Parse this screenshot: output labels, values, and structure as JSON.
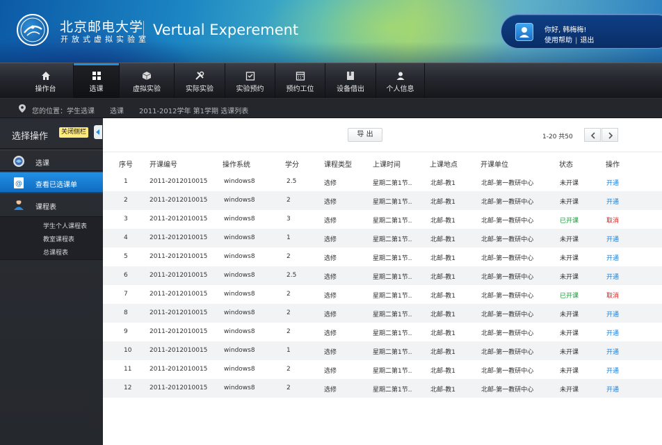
{
  "header": {
    "university": "北京邮电大学",
    "lab": "开放式虚拟实验室",
    "app_title": "Vertual Experement",
    "greeting": "你好, 韩梅梅!",
    "help": "使用帮助",
    "logout": "退出",
    "link_separator": "|"
  },
  "nav": [
    {
      "label": "操作台",
      "icon": "home-icon"
    },
    {
      "label": "选课",
      "icon": "grid-icon",
      "active": true
    },
    {
      "label": "虚拟实验",
      "icon": "cube-icon"
    },
    {
      "label": "实际实验",
      "icon": "tools-icon"
    },
    {
      "label": "实验预约",
      "icon": "calendar-check-icon"
    },
    {
      "label": "预约工位",
      "icon": "calendar-icon"
    },
    {
      "label": "设备借出",
      "icon": "book-icon"
    },
    {
      "label": "个人信息",
      "icon": "person-icon"
    }
  ],
  "breadcrumb": {
    "prefix": "您的位置：学生选课",
    "level2": "选课",
    "level3": "2011-2012学年 第1学期 选课列表"
  },
  "sidebar": {
    "title": "选择操作",
    "close_label": "关闭侧栏",
    "items": [
      {
        "label": "选课",
        "icon": "globe-icon"
      },
      {
        "label": "查看已选课单",
        "icon": "at-icon",
        "active": true
      },
      {
        "label": "课程表",
        "icon": "user-icon"
      }
    ],
    "sub_items": [
      "学生个人课程表",
      "教室课程表",
      "总课程表"
    ]
  },
  "toolbar": {
    "export_label": "导 出",
    "pager_text": "1-20  共50"
  },
  "table": {
    "headers": [
      "序号",
      "开课编号",
      "操作系统",
      "学分",
      "课程类型",
      "上课时间",
      "上课地点",
      "开课单位",
      "状态",
      "操作"
    ],
    "rows": [
      [
        "1",
        "2011-2012010015",
        "windows8",
        "2.5",
        "选修",
        "星期二第1节..",
        "北邮-教1",
        "北邮-第一教研中心",
        "未开课",
        "开通"
      ],
      [
        "2",
        "2011-2012010015",
        "windows8",
        "2",
        "选修",
        "星期二第1节..",
        "北邮-教1",
        "北邮-第一教研中心",
        "未开课",
        "开通"
      ],
      [
        "3",
        "2011-2012010015",
        "windows8",
        "3",
        "选修",
        "星期二第1节..",
        "北邮-教1",
        "北邮-第一教研中心",
        "已开课",
        "取消"
      ],
      [
        "4",
        "2011-2012010015",
        "windows8",
        "1",
        "选修",
        "星期二第1节..",
        "北邮-教1",
        "北邮-第一教研中心",
        "未开课",
        "开通"
      ],
      [
        "5",
        "2011-2012010015",
        "windows8",
        "2",
        "选修",
        "星期二第1节..",
        "北邮-教1",
        "北邮-第一教研中心",
        "未开课",
        "开通"
      ],
      [
        "6",
        "2011-2012010015",
        "windows8",
        "2.5",
        "选修",
        "星期二第1节..",
        "北邮-教1",
        "北邮-第一教研中心",
        "未开课",
        "开通"
      ],
      [
        "7",
        "2011-2012010015",
        "windows8",
        "2",
        "选修",
        "星期二第1节..",
        "北邮-教1",
        "北邮-第一教研中心",
        "已开课",
        "取消"
      ],
      [
        "8",
        "2011-2012010015",
        "windows8",
        "2",
        "选修",
        "星期二第1节..",
        "北邮-教1",
        "北邮-第一教研中心",
        "未开课",
        "开通"
      ],
      [
        "9",
        "2011-2012010015",
        "windows8",
        "2",
        "选修",
        "星期二第1节..",
        "北邮-教1",
        "北邮-第一教研中心",
        "未开课",
        "开通"
      ],
      [
        "10",
        "2011-2012010015",
        "windows8",
        "1",
        "选修",
        "星期二第1节..",
        "北邮-教1",
        "北邮-第一教研中心",
        "未开课",
        "开通"
      ],
      [
        "11",
        "2011-2012010015",
        "windows8",
        "2",
        "选修",
        "星期二第1节..",
        "北邮-教1",
        "北邮-第一教研中心",
        "未开课",
        "开通"
      ],
      [
        "12",
        "2011-2012010015",
        "windows8",
        "2",
        "选修",
        "星期二第1节..",
        "北邮-教1",
        "北邮-第一教研中心",
        "未开课",
        "开通"
      ]
    ]
  },
  "colors": {
    "accent": "#1e8fe0",
    "status_open": "#1a9a3a",
    "action_open": "#1a7fd6",
    "action_cancel": "#d52626"
  }
}
